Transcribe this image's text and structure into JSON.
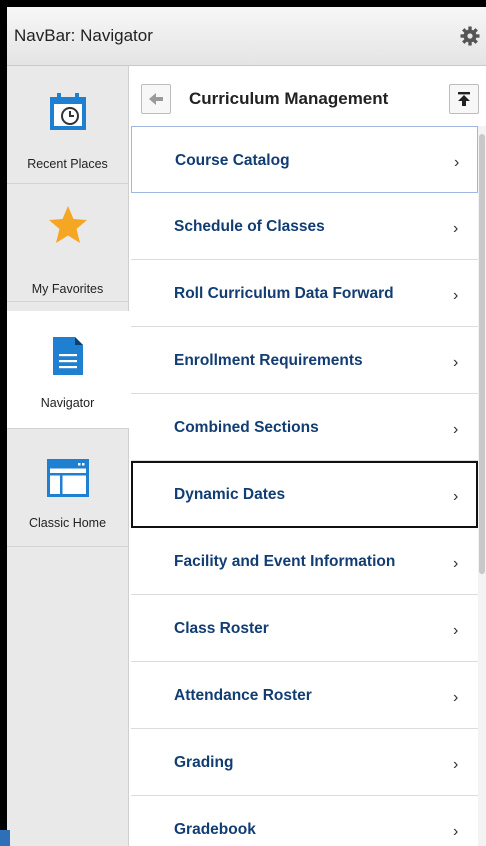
{
  "navbar": {
    "title": "NavBar: Navigator"
  },
  "rail": {
    "items": [
      {
        "label": "Recent Places",
        "icon": "recent-places-icon"
      },
      {
        "label": "My Favorites",
        "icon": "star-icon"
      },
      {
        "label": "Navigator",
        "icon": "document-icon",
        "active": true
      },
      {
        "label": "Classic Home",
        "icon": "window-icon"
      }
    ]
  },
  "panel": {
    "title": "Curriculum Management",
    "items": [
      {
        "label": "Course Catalog"
      },
      {
        "label": "Schedule of Classes"
      },
      {
        "label": "Roll Curriculum Data Forward"
      },
      {
        "label": "Enrollment Requirements"
      },
      {
        "label": "Combined Sections"
      },
      {
        "label": "Dynamic Dates"
      },
      {
        "label": "Facility and Event Information"
      },
      {
        "label": "Class Roster"
      },
      {
        "label": "Attendance Roster"
      },
      {
        "label": "Grading"
      },
      {
        "label": "Gradebook"
      }
    ]
  },
  "colors": {
    "accent": "#123d73",
    "star": "#f5a623",
    "brand_blue": "#1f7fd0"
  }
}
